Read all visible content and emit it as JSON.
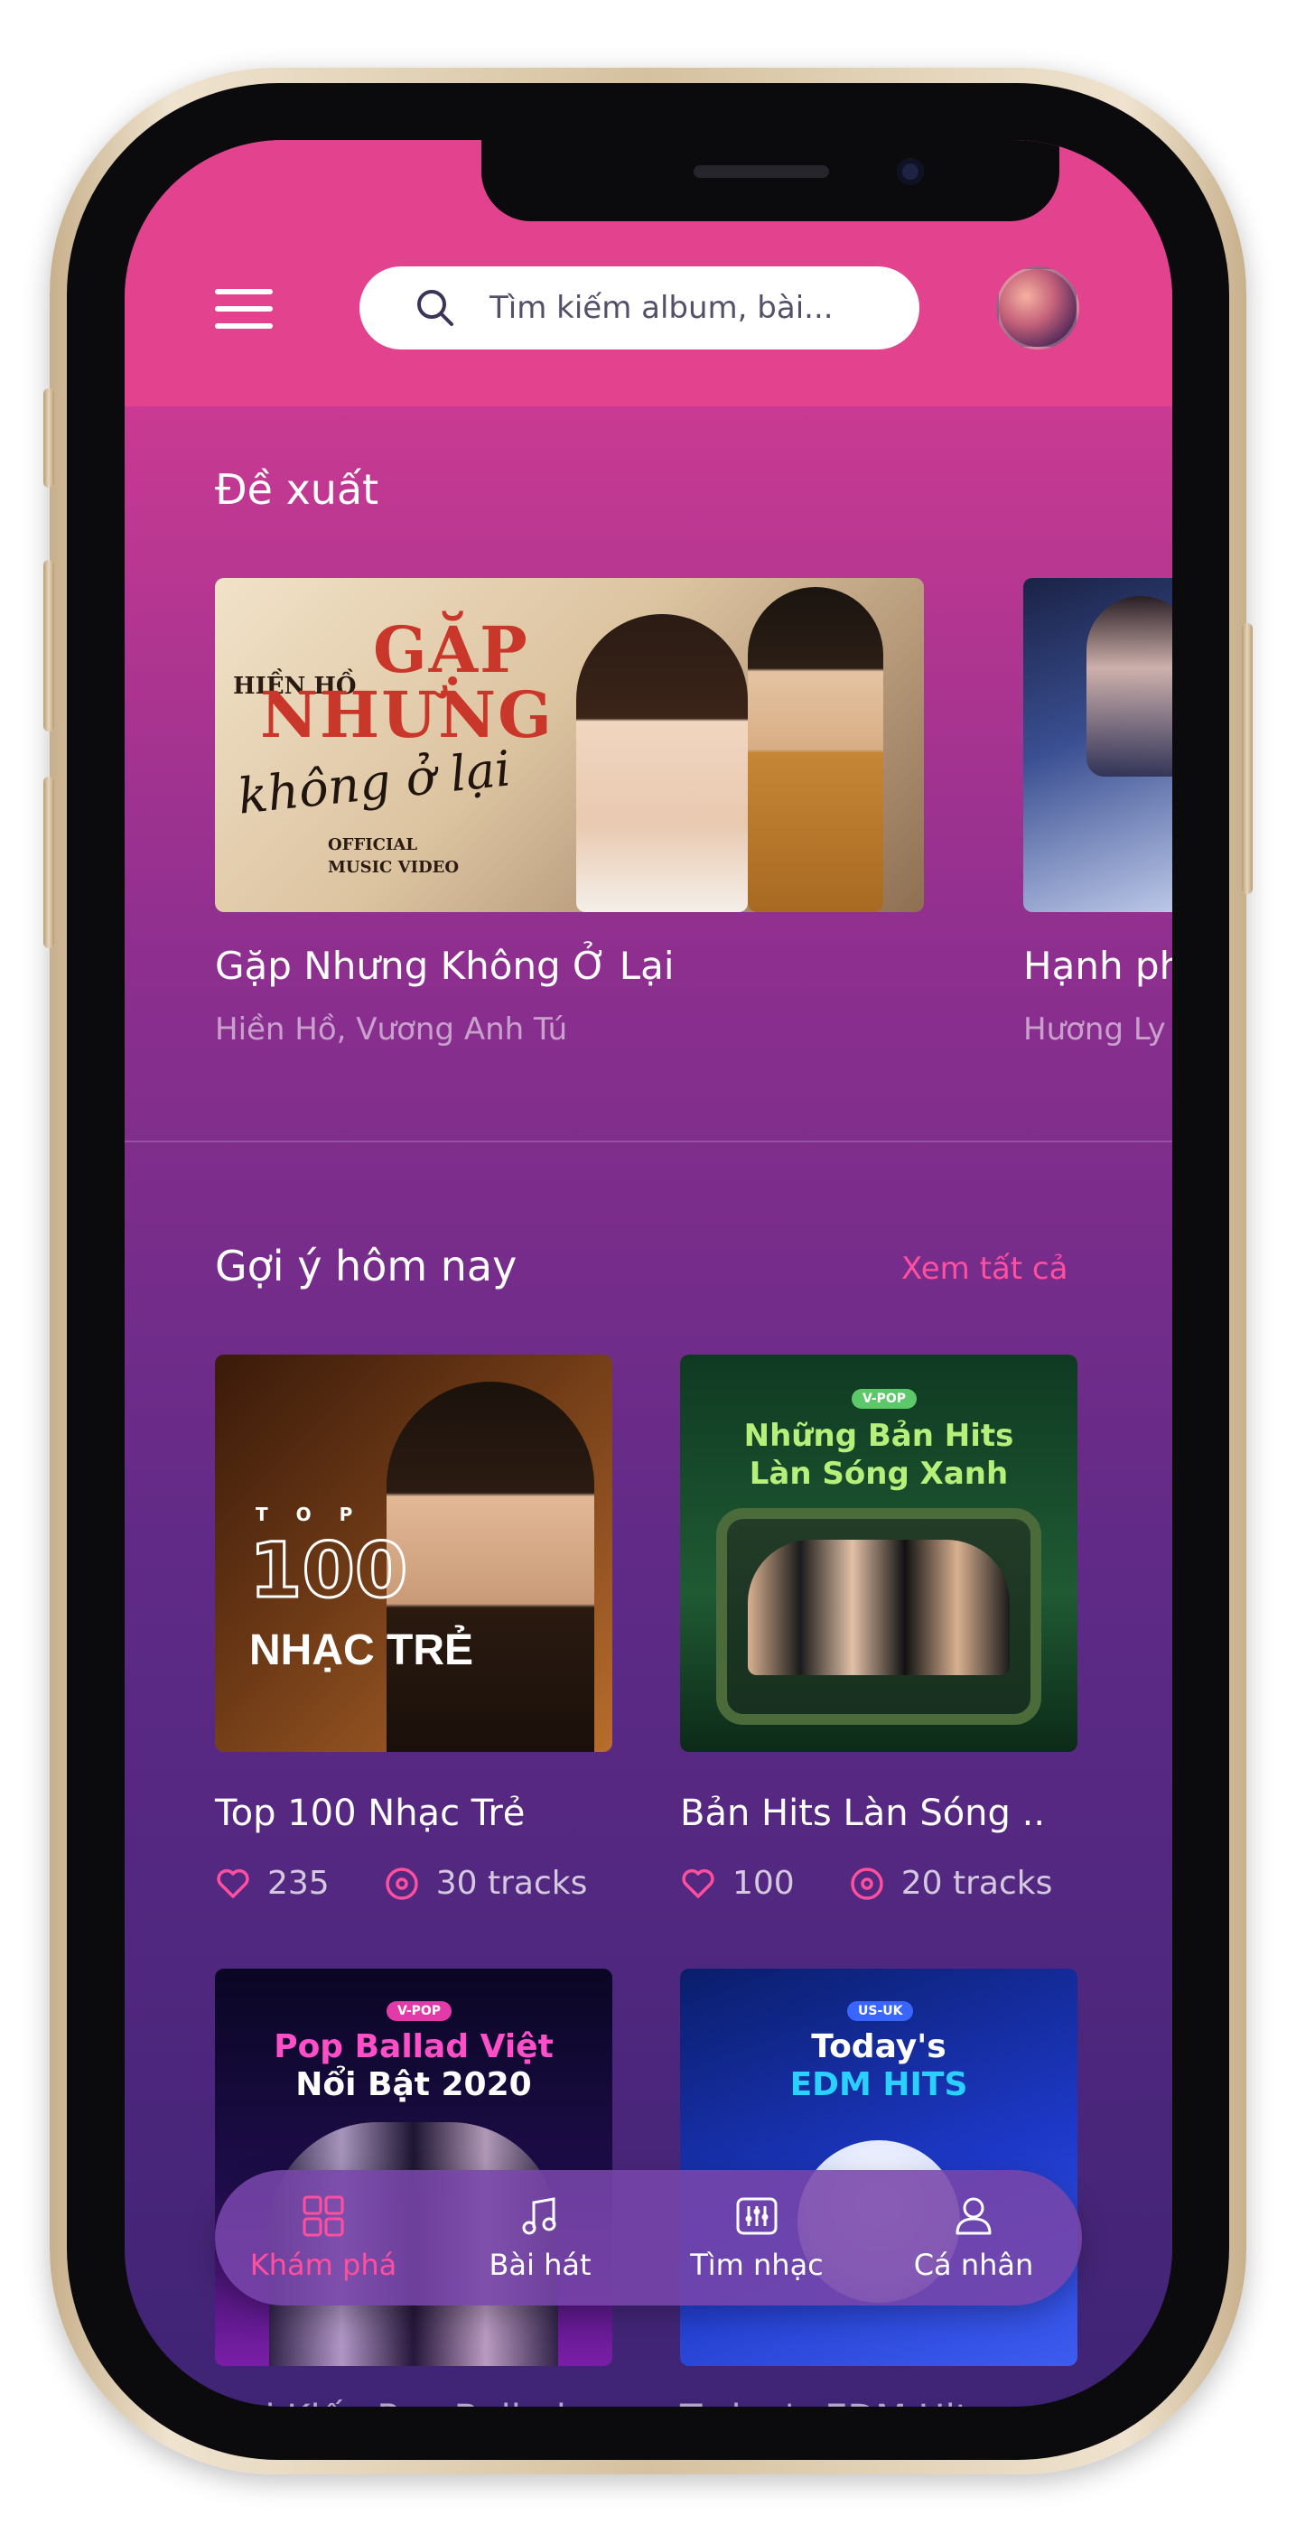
{
  "header": {
    "search_placeholder": "Tìm kiếm album, bài..."
  },
  "featured": {
    "title": "Đề xuất",
    "items": [
      {
        "title": "Gặp Nhưng Không Ở Lại",
        "artists": "Hiền Hồ, Vương Anh Tú",
        "poster_artist": "HIỀN HỒ",
        "poster_line1": "GẶP",
        "poster_line2": "NHƯNG",
        "poster_script": "không ở lại",
        "poster_footer1": "OFFICIAL",
        "poster_footer2": "MUSIC VIDEO"
      },
      {
        "title": "Hạnh ph",
        "artists": "Hương Ly"
      }
    ]
  },
  "today": {
    "title": "Gợi ý hôm nay",
    "see_all": "Xem tất cả",
    "albums": [
      {
        "title": "Top 100 Nhạc Trẻ",
        "likes": "235",
        "tracks": "30 tracks",
        "art_top": "T O P",
        "art_number": "100",
        "art_label": "NHẠC TRẺ"
      },
      {
        "title": "Bản Hits Làn Sóng ..",
        "likes": "100",
        "tracks": "20 tracks",
        "art_tag": "V-POP",
        "art_line1": "Những Bản Hits",
        "art_line2": "Làn Sóng Xanh"
      },
      {
        "title": "Gợi Kiếp Pop Ballad",
        "art_tag": "V-POP",
        "art_line1": "Pop Ballad Việt",
        "art_line2": "Nổi Bật 2020"
      },
      {
        "title": "Today's EDM Hits",
        "art_tag": "US-UK",
        "art_line1": "Today's",
        "art_line2": "EDM HITS"
      }
    ]
  },
  "nav": [
    {
      "label": "Khám phá",
      "icon": "grid-icon",
      "active": true
    },
    {
      "label": "Bài hát",
      "icon": "music-note-icon",
      "active": false
    },
    {
      "label": "Tìm nhạc",
      "icon": "equalizer-icon",
      "active": false
    },
    {
      "label": "Cá nhân",
      "icon": "user-icon",
      "active": false
    }
  ],
  "colors": {
    "header": "#e3428f",
    "accent": "#ff4f9e"
  }
}
